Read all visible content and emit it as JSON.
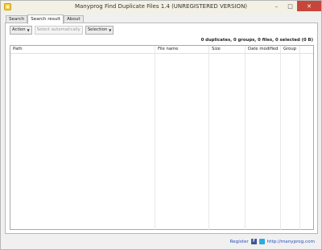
{
  "window": {
    "title": "Manyprog Find Duplicate Files 1.4 (UNREGISTERED VERSION)",
    "controls": {
      "minimize": "–",
      "maximize": "□",
      "close": "✕"
    }
  },
  "tabs": [
    {
      "label": "Search",
      "active": false
    },
    {
      "label": "Search result",
      "active": true
    },
    {
      "label": "About",
      "active": false
    }
  ],
  "toolbar": {
    "action_label": "Action",
    "select_auto_label": "Select automatically",
    "selection_label": "Selection"
  },
  "summary": "0 duplicates, 0 groups, 0 files, 0 selected (0 B)",
  "table": {
    "columns": [
      "Path",
      "File name",
      "Size",
      "Date modified",
      "Group"
    ],
    "rows": []
  },
  "footer": {
    "register_label": "Register",
    "website_label": "http://manyprog.com"
  },
  "icons": {
    "app": "app-icon",
    "facebook": "facebook-icon",
    "twitter": "twitter-icon"
  }
}
